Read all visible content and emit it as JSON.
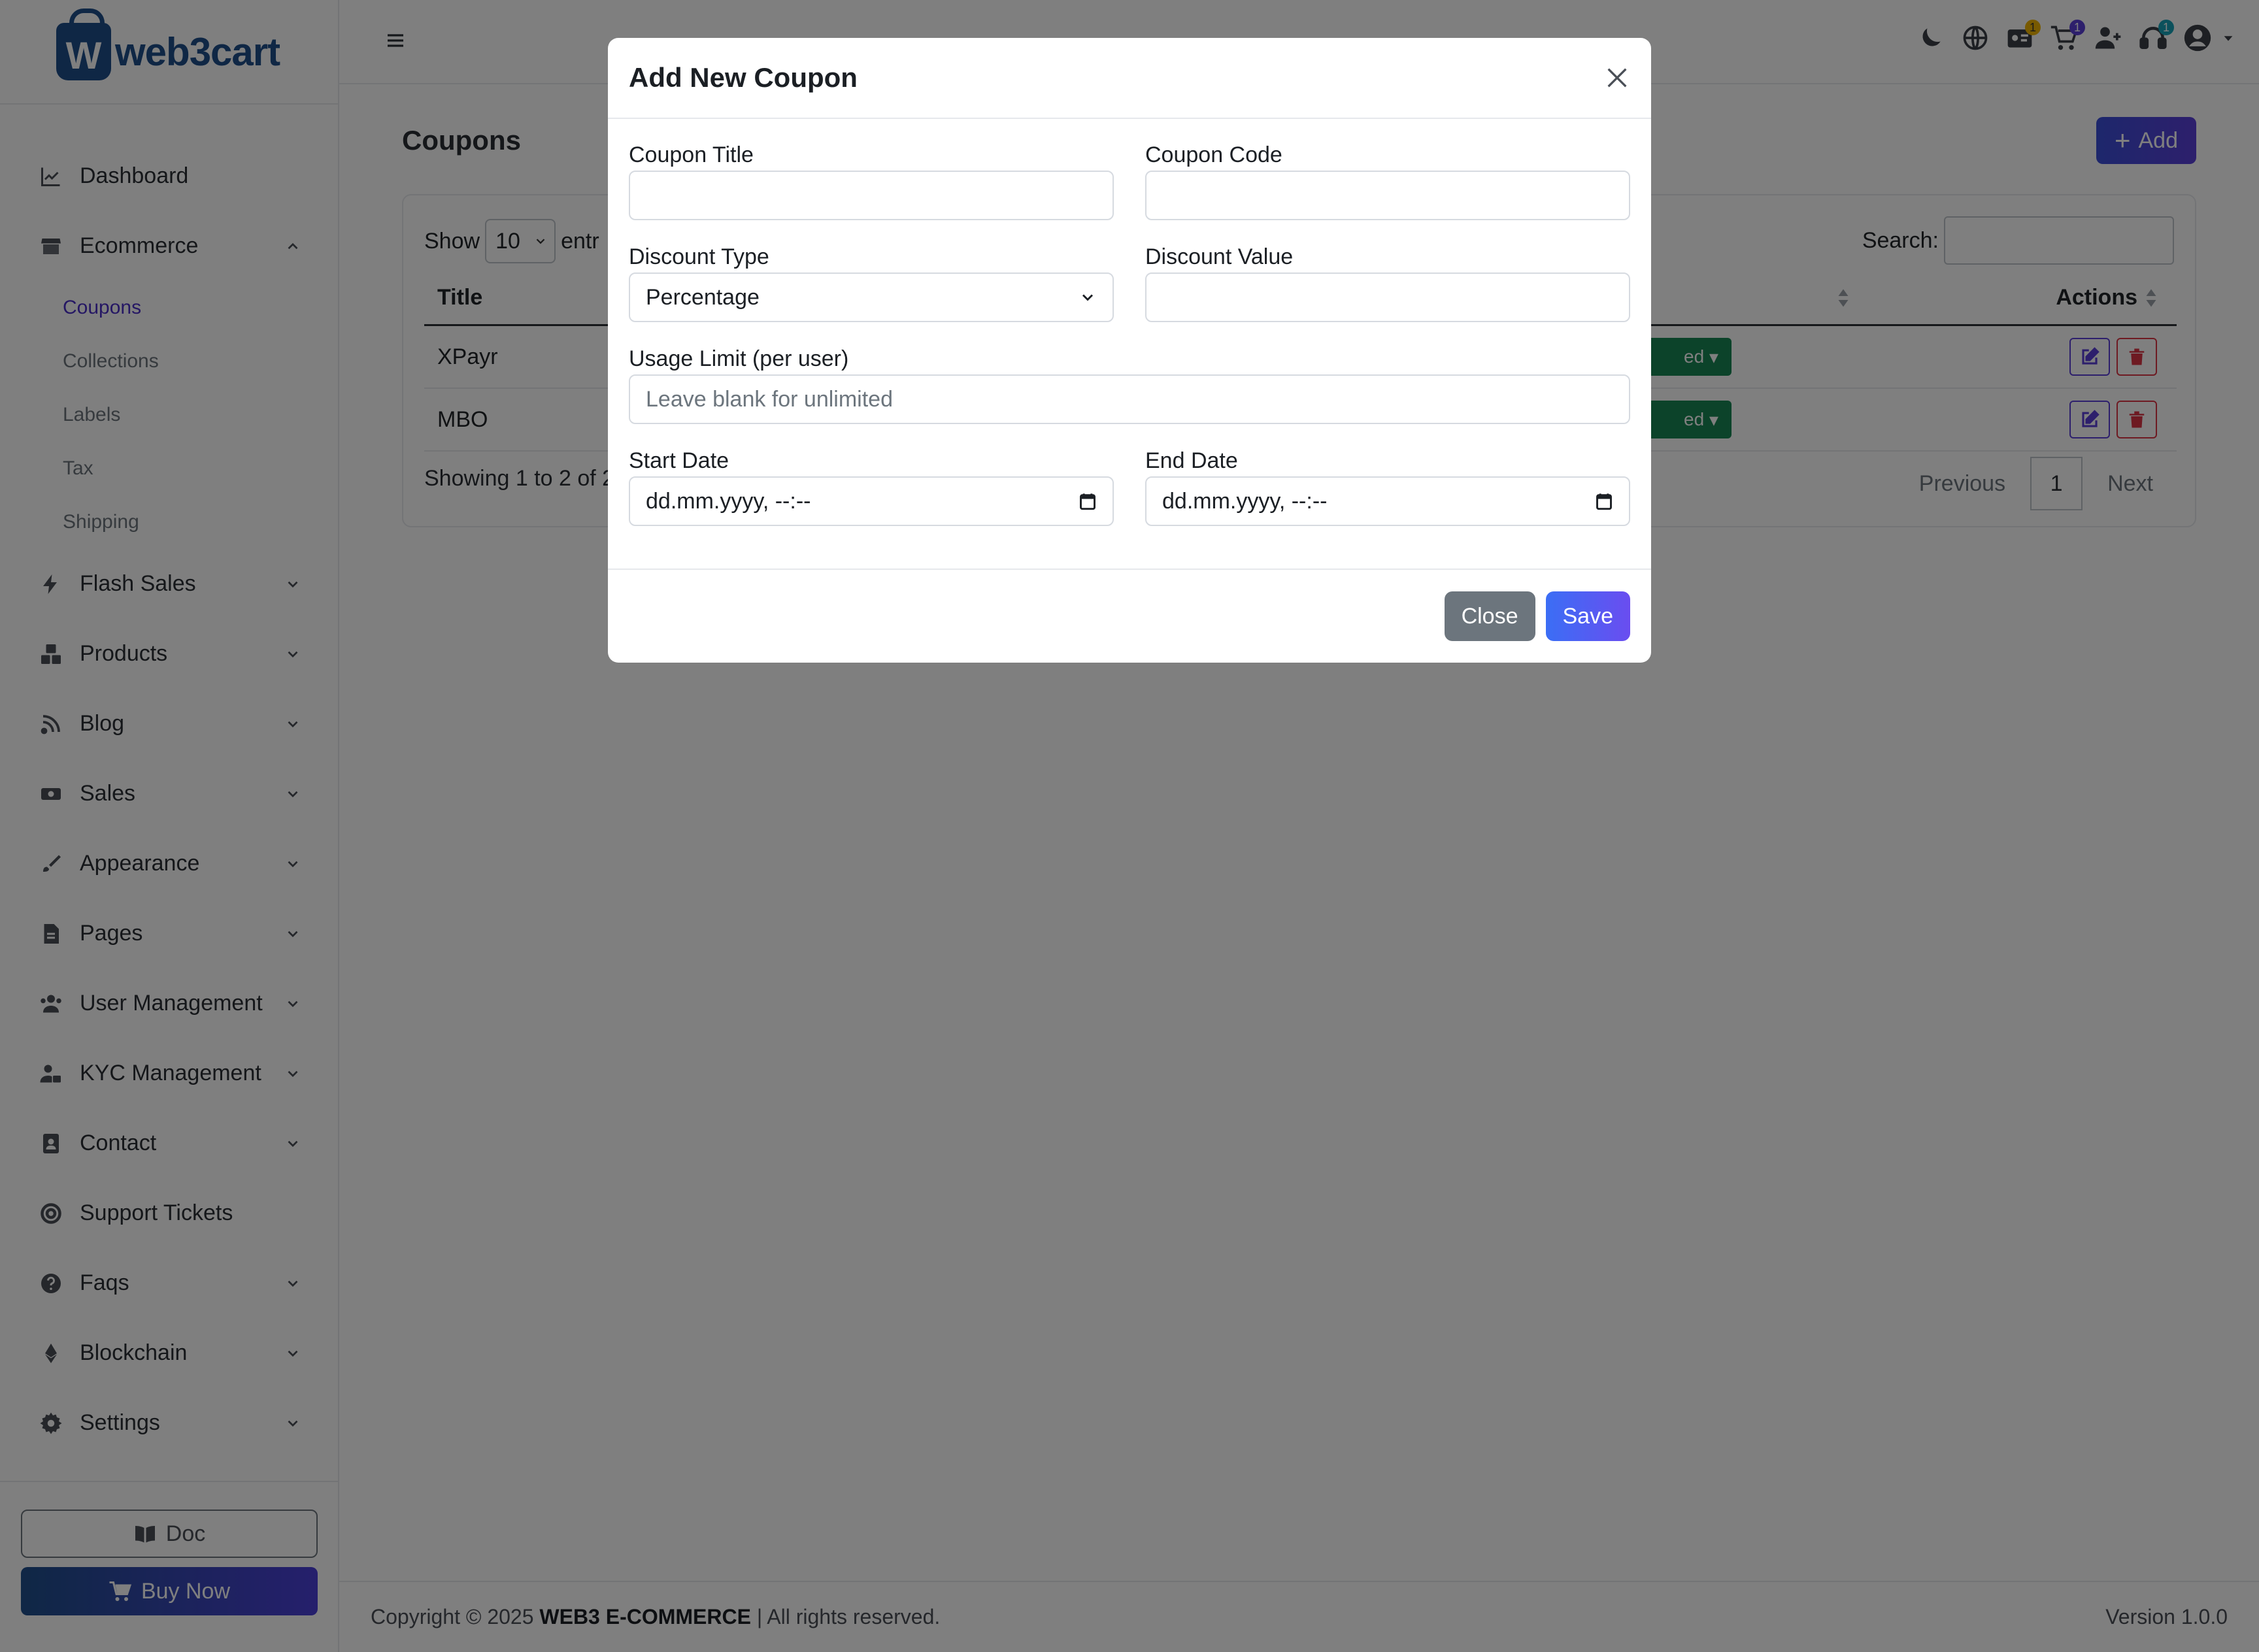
{
  "brand": {
    "name": "web3cart",
    "logo_letter": "W"
  },
  "sidebar": {
    "items": [
      {
        "label": "Dashboard",
        "icon": "chart-line-icon",
        "has_chevron": false
      },
      {
        "label": "Ecommerce",
        "icon": "store-icon",
        "has_chevron": true,
        "expanded": true
      },
      {
        "label": "Flash Sales",
        "icon": "bolt-icon",
        "has_chevron": true
      },
      {
        "label": "Products",
        "icon": "boxes-icon",
        "has_chevron": true
      },
      {
        "label": "Blog",
        "icon": "blog-icon",
        "has_chevron": true
      },
      {
        "label": "Sales",
        "icon": "money-icon",
        "has_chevron": true
      },
      {
        "label": "Appearance",
        "icon": "brush-icon",
        "has_chevron": true
      },
      {
        "label": "Pages",
        "icon": "file-icon",
        "has_chevron": true
      },
      {
        "label": "User Management",
        "icon": "users-icon",
        "has_chevron": true
      },
      {
        "label": "KYC Management",
        "icon": "user-lock-icon",
        "has_chevron": true
      },
      {
        "label": "Contact",
        "icon": "address-book-icon",
        "has_chevron": true
      },
      {
        "label": "Support Tickets",
        "icon": "life-ring-icon",
        "has_chevron": false
      },
      {
        "label": "Faqs",
        "icon": "question-circle-icon",
        "has_chevron": true
      },
      {
        "label": "Blockchain",
        "icon": "ethereum-icon",
        "has_chevron": true
      },
      {
        "label": "Settings",
        "icon": "gear-icon",
        "has_chevron": true
      }
    ],
    "ecommerce_sub": [
      "Coupons",
      "Collections",
      "Labels",
      "Tax",
      "Shipping"
    ],
    "active_sub": "Coupons",
    "doc_label": "Doc",
    "buy_label": "Buy Now"
  },
  "topbar": {
    "badges": {
      "kyc": "1",
      "orders": "1",
      "support": "1"
    }
  },
  "page": {
    "title": "Coupons",
    "add_label": "Add"
  },
  "table": {
    "show_label": "Show",
    "length_value": "10",
    "entries_label": "entr",
    "search_label": "Search:",
    "headers": {
      "title": "Title",
      "status": "s",
      "actions": "Actions"
    },
    "rows": [
      {
        "title": "XPayr",
        "status": "ed"
      },
      {
        "title": "MBO",
        "status": "ed"
      }
    ],
    "info": "Showing 1 to 2 of 2",
    "prev": "Previous",
    "page": "1",
    "next": "Next"
  },
  "footer": {
    "copyright_prefix": "Copyright © 2025 ",
    "company": "WEB3 E-COMMERCE",
    "copyright_suffix": " | All rights reserved.",
    "version": "Version 1.0.0"
  },
  "modal": {
    "title": "Add New Coupon",
    "fields": {
      "coupon_title": {
        "label": "Coupon Title",
        "value": ""
      },
      "coupon_code": {
        "label": "Coupon Code",
        "value": ""
      },
      "discount_type": {
        "label": "Discount Type",
        "value": "Percentage"
      },
      "discount_value": {
        "label": "Discount Value",
        "value": ""
      },
      "usage_limit": {
        "label": "Usage Limit (per user)",
        "placeholder": "Leave blank for unlimited"
      },
      "start_date": {
        "label": "Start Date",
        "value": "dd.mm.yyyy, --:--"
      },
      "end_date": {
        "label": "End Date",
        "value": "dd.mm.yyyy, --:--"
      }
    },
    "close_label": "Close",
    "save_label": "Save"
  }
}
